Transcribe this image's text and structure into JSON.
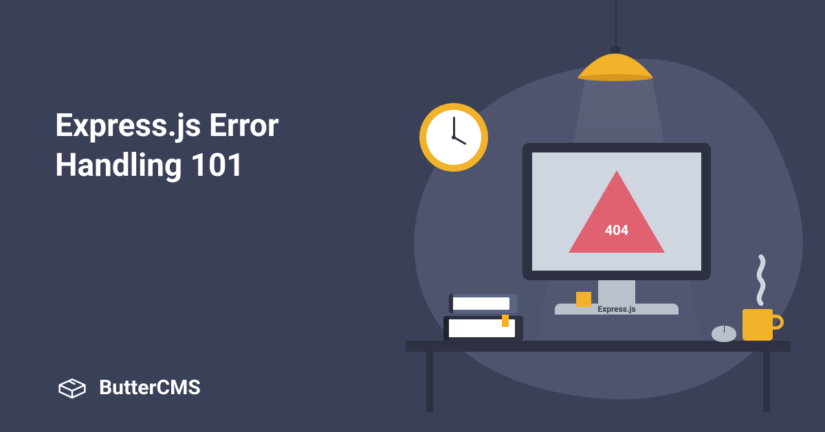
{
  "title_line1": "Express.js Error",
  "title_line2": "Handling 101",
  "brand": "ButterCMS",
  "monitor": {
    "error_code": "404",
    "label": "Express.js"
  },
  "colors": {
    "background": "#3a4058",
    "blob": "#4e536e",
    "accent_yellow": "#f2b22a",
    "accent_red": "#e06271",
    "dark": "#2d3142",
    "light_gray": "#cfd6e0",
    "mid_gray": "#b9c1cc"
  }
}
